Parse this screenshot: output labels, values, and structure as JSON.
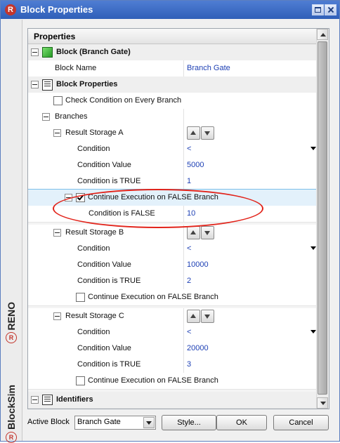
{
  "window": {
    "title": "Block Properties"
  },
  "sidebar": {
    "brand_top": "RENO",
    "brand_bottom": "BlockSim",
    "logo_glyph": "R"
  },
  "grid": {
    "header": "Properties",
    "block_category": "Block (Branch Gate)",
    "block_name_label": "Block Name",
    "block_name_value": "Branch Gate",
    "props_category": "Block Properties",
    "check_condition_label": "Check Condition on Every Branch",
    "branches_label": "Branches",
    "storages": [
      {
        "name": "Result Storage A",
        "condition_label": "Condition",
        "condition_value": "<",
        "cond_value_label": "Condition Value",
        "cond_value": "5000",
        "true_label": "Condition is TRUE",
        "true_value": "1",
        "continue_label": "Continue Execution on FALSE Branch",
        "continue_checked": true,
        "false_label": "Condition is FALSE",
        "false_value": "10"
      },
      {
        "name": "Result Storage B",
        "condition_label": "Condition",
        "condition_value": "<",
        "cond_value_label": "Condition Value",
        "cond_value": "10000",
        "true_label": "Condition is TRUE",
        "true_value": "2",
        "continue_label": "Continue Execution on FALSE Branch",
        "continue_checked": false
      },
      {
        "name": "Result Storage C",
        "condition_label": "Condition",
        "condition_value": "<",
        "cond_value_label": "Condition Value",
        "cond_value": "20000",
        "true_label": "Condition is TRUE",
        "true_value": "3",
        "continue_label": "Continue Execution on FALSE Branch",
        "continue_checked": false
      }
    ],
    "identifiers_category": "Identifiers"
  },
  "footer": {
    "active_block_label": "Active Block",
    "active_block_value": "Branch Gate",
    "style_button": "Style...",
    "ok_button": "OK",
    "cancel_button": "Cancel"
  },
  "colors": {
    "title_bar": "#3a6ac6",
    "value_text": "#1c3fb4",
    "highlight_ellipse": "#e2231a",
    "selected_row": "#e3f1fb"
  }
}
